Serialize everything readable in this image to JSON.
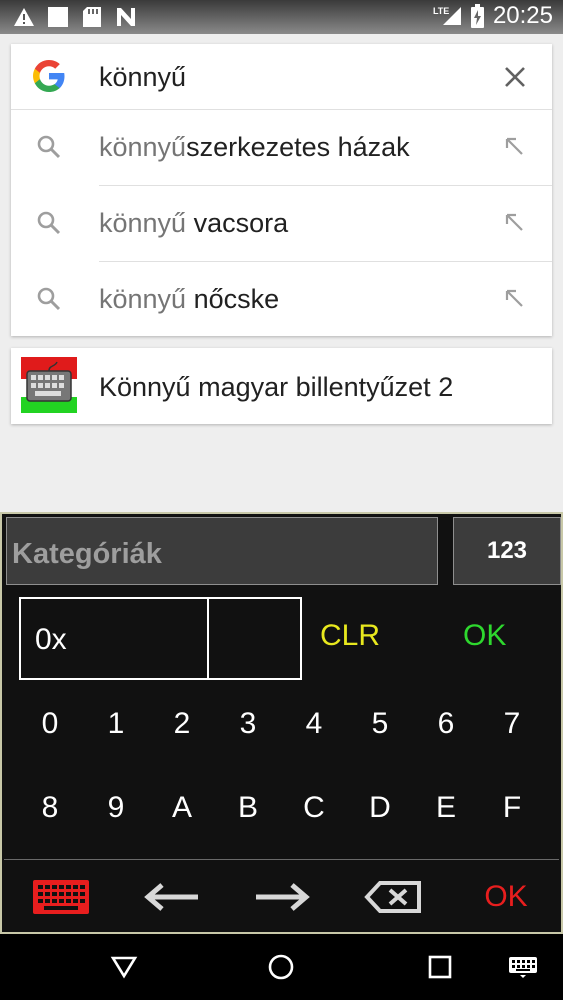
{
  "status_bar": {
    "time": "20:25",
    "network_label": "LTE",
    "left_icons": [
      "warning-icon",
      "square-icon",
      "sd-card-icon",
      "no-signal-icon"
    ],
    "right_icons": [
      "signal-icon",
      "battery-charging-icon"
    ]
  },
  "search": {
    "query": "könnyű",
    "suggestions": [
      {
        "prefix": "könnyű",
        "rest": "szerkezetes házak"
      },
      {
        "prefix": "könnyű",
        "rest": " vacsora"
      },
      {
        "prefix": "könnyű",
        "rest": " nőcske"
      }
    ]
  },
  "app_result": {
    "name": "Könnyű magyar billentyűzet 2"
  },
  "keyboard": {
    "category_label": "Kategóriák",
    "mode_button": "123",
    "hex_value": "0x",
    "clr_label": "CLR",
    "ok_top_label": "OK",
    "keys_row1": [
      "0",
      "1",
      "2",
      "3",
      "4",
      "5",
      "6",
      "7"
    ],
    "keys_row2": [
      "8",
      "9",
      "A",
      "B",
      "C",
      "D",
      "E",
      "F"
    ],
    "ok_bottom_label": "OK",
    "colors": {
      "clr": "#e8e81e",
      "ok_top": "#2ed82e",
      "ok_bottom": "#e81e1e",
      "keyboard_icon": "#e81e1e"
    }
  },
  "nav": {
    "icons": [
      "back-icon",
      "home-icon",
      "recents-icon",
      "keyboard-switch-icon"
    ]
  }
}
